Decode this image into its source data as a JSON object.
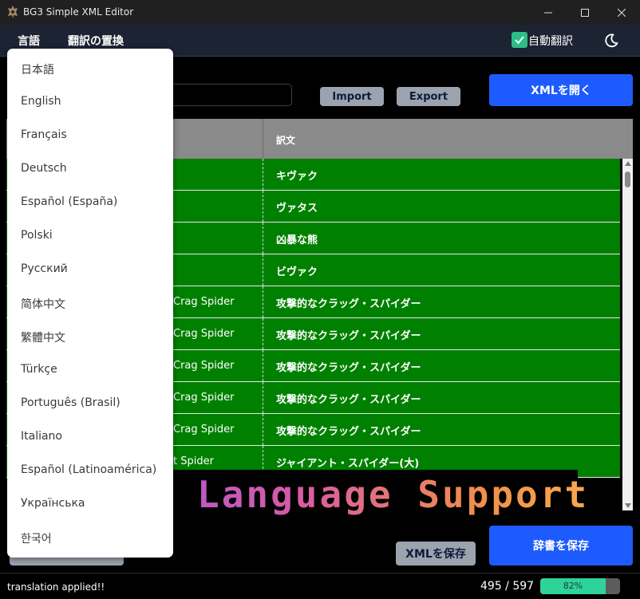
{
  "window": {
    "title": "BG3 Simple XML Editor"
  },
  "menu": {
    "language": "言語",
    "replace": "翻訳の置換",
    "auto_translate": "自動翻訳"
  },
  "toolbar": {
    "search_placeholder": "h",
    "import_label": "Import",
    "export_label": "Export",
    "open_xml_label": "XMLを開く"
  },
  "table": {
    "col_translation": "訳文",
    "rows": [
      {
        "source": "",
        "translation": "キヴァク"
      },
      {
        "source": "",
        "translation": "ヴァタス"
      },
      {
        "source": "",
        "translation": "凶暴な熊"
      },
      {
        "source": "",
        "translation": "ビヴァク"
      },
      {
        "source": "Crag Spider",
        "translation": "攻撃的なクラッグ・スパイダー"
      },
      {
        "source": "Crag Spider",
        "translation": "攻撃的なクラッグ・スパイダー"
      },
      {
        "source": "Crag Spider",
        "translation": "攻撃的なクラッグ・スパイダー"
      },
      {
        "source": "Crag Spider",
        "translation": "攻撃的なクラッグ・スパイダー"
      },
      {
        "source": "Crag Spider",
        "translation": "攻撃的なクラッグ・スパイダー"
      },
      {
        "source": "t Spider",
        "translation": "ジャイアント・スパイダー(大)"
      }
    ]
  },
  "language_dropdown": {
    "options": [
      "日本語",
      "English",
      "Français",
      "Deutsch",
      "Español (España)",
      "Polski",
      "Русский",
      "简体中文",
      "繁體中文",
      "Türkçe",
      "Português (Brasil)",
      "Italiano",
      "Español (Latinoamérica)",
      "Українська",
      "한국어"
    ]
  },
  "banner": {
    "text": "Multi Language Support"
  },
  "footer": {
    "save_xml_label": "XMLを保存",
    "save_dict_label": "辞書を保存"
  },
  "status": {
    "message": "translation applied!!",
    "count": "495 / 597",
    "progress_percent": 82,
    "progress_label": "82%"
  },
  "colors": {
    "accent_blue": "#1d5bff",
    "row_green": "#008000",
    "progress_green": "#2ed39a",
    "header_gray": "#8a8a8a"
  }
}
